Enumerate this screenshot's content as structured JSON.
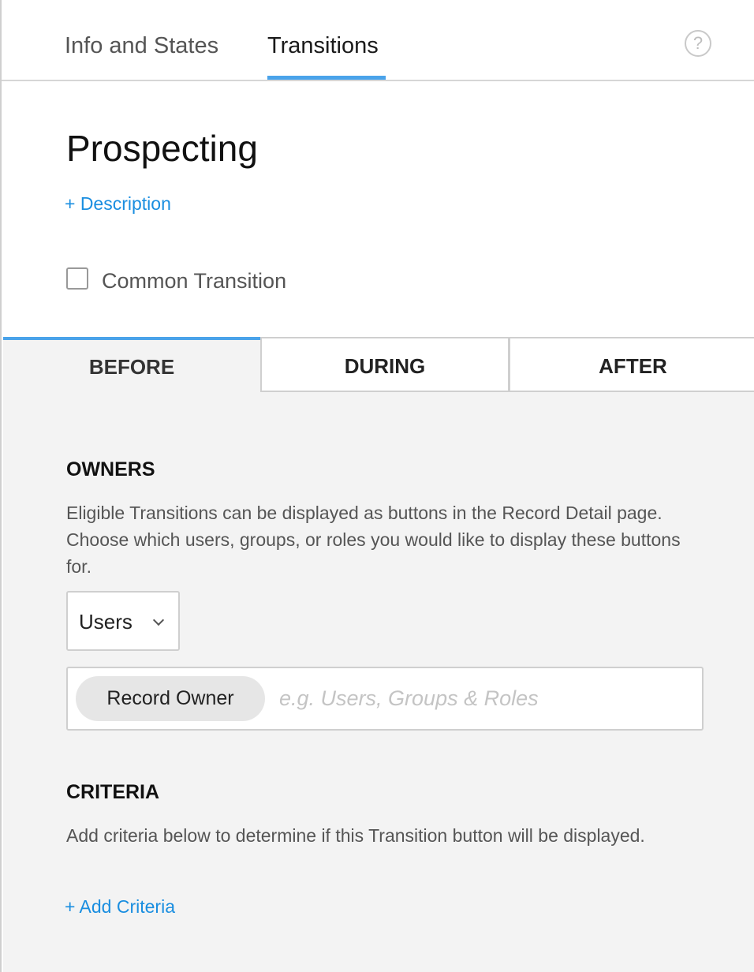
{
  "top_tabs": {
    "info_label": "Info and States",
    "transitions_label": "Transitions",
    "help_icon_glyph": "?"
  },
  "header": {
    "title": "Prospecting",
    "add_description": "+ Description",
    "common_transition_label": "Common Transition",
    "common_transition_checked": false
  },
  "sub_tabs": {
    "before": "BEFORE",
    "during": "DURING",
    "after": "AFTER",
    "active": "BEFORE"
  },
  "owners": {
    "heading": "OWNERS",
    "description": "Eligible Transitions can be displayed as buttons in the Record Detail page. Choose which users, groups, or roles you would like to display these buttons for.",
    "select_value": "Users",
    "chip_label": "Record Owner",
    "input_placeholder": "e.g. Users, Groups & Roles"
  },
  "criteria": {
    "heading": "CRITERIA",
    "description": "Add criteria below to determine if this Transition button will be displayed.",
    "add_label": "+ Add Criteria"
  },
  "colors": {
    "accent": "#4aa3ea",
    "link": "#1a8ee0",
    "panel_bg": "#f3f3f3"
  }
}
